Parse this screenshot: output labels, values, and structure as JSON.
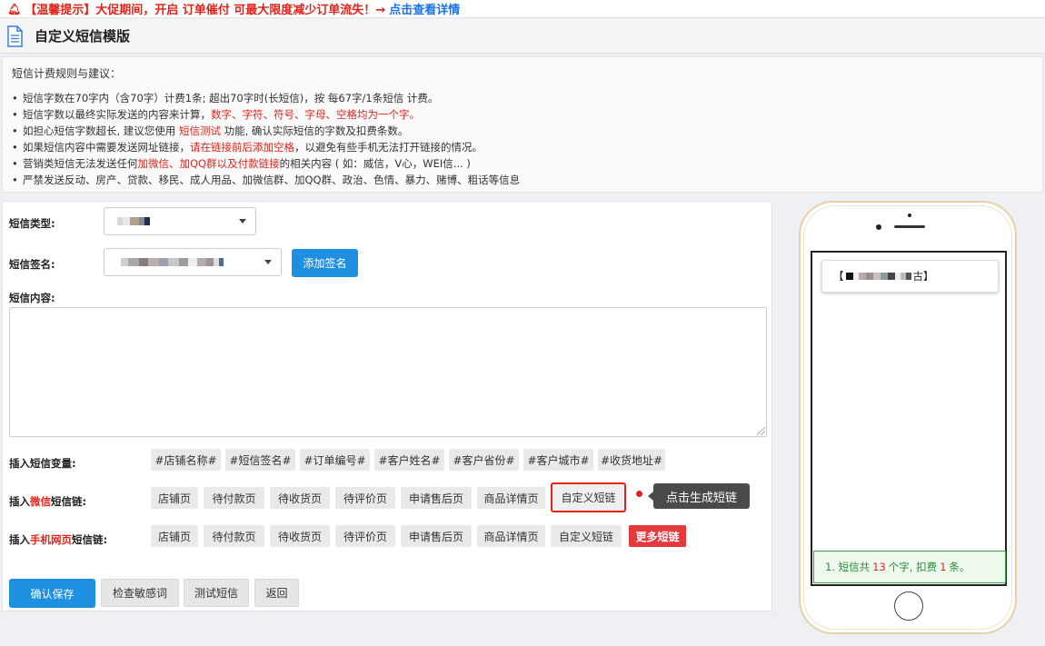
{
  "notice": {
    "prefix": "【温馨提示】",
    "message": "大促期间，开启 订单催付 可最大限度减少订单流失！→",
    "link": "点击查看详情"
  },
  "page": {
    "title": "自定义短信模版"
  },
  "rules": {
    "heading": "短信计费规则与建议：",
    "items": [
      {
        "a": "短信字数在70字内（含70字）计费1条; 超出70字时(长短信)，按 每67字/1条短信 计费。",
        "red": "",
        "b": ""
      },
      {
        "a": "短信字数以最终实际发送的内容来计算，",
        "red": "数字、字符、符号、字母、空格均为一个字。",
        "b": ""
      },
      {
        "a": "如担心短信字数超长, 建议您使用 ",
        "red": "短信测试",
        "b": " 功能, 确认实际短信的字数及扣费条数。"
      },
      {
        "a": "如果短信内容中需要发送网址链接，",
        "red": "请在链接前后添加空格",
        "b": "，以避免有些手机无法打开链接的情况。"
      },
      {
        "a": "营销类短信无法发送任何",
        "red": "加微信、加QQ群以及付款链接",
        "b": "的相关内容 ( 如：威信，V心，WEI信... )"
      },
      {
        "a": "严禁发送反动、房产、贷款、移民、成人用品、加微信群、加QQ群、政治、色情、暴力、赌博、粗话等信息",
        "red": "",
        "b": ""
      }
    ]
  },
  "form": {
    "sms_type_label": "短信类型:",
    "signature_label": "短信签名:",
    "add_signature": "添加签名",
    "content_label": "短信内容:",
    "content_value": "",
    "variables_label": "插入短信变量:",
    "variables": [
      "#店铺名称#",
      "#短信签名#",
      "#订单编号#",
      "#客户姓名#",
      "#客户省份#",
      "#客户城市#",
      "#收货地址#"
    ],
    "wechat_label_pre": "插入",
    "wechat_label_red": "微信",
    "wechat_label_post": "短信链:",
    "mobile_label_pre": "插入",
    "mobile_label_red": "手机网页",
    "mobile_label_post": "短信链:",
    "link_buttons": [
      "店铺页",
      "待付款页",
      "待收货页",
      "待评价页",
      "申请售后页",
      "商品详情页",
      "自定义短链"
    ],
    "more_links": "更多短链",
    "tooltip": "点击生成短链",
    "actions": {
      "save": "确认保存",
      "check": "检查敏感词",
      "test": "测试短信",
      "back": "返回"
    }
  },
  "preview": {
    "open_bracket": "【",
    "sig_tail": "古】",
    "count_pre": "1. 短信共",
    "count_chars": "13",
    "count_mid": "个字, 扣费",
    "count_items": "1",
    "count_post": "条。"
  },
  "colors": {
    "accent": "#1e8fe1",
    "danger": "#e2231a",
    "success": "#2e8b3a"
  }
}
